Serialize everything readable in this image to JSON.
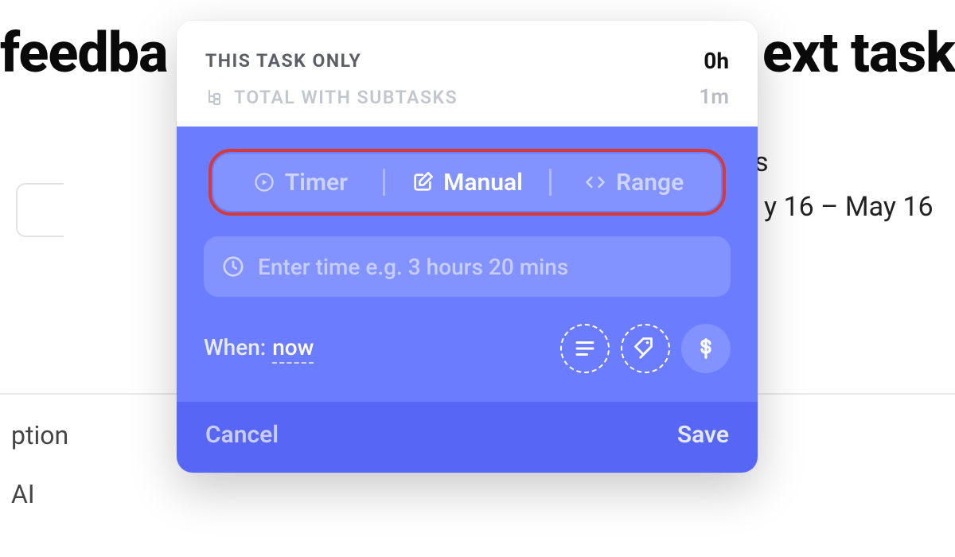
{
  "background": {
    "title_left_fragment": "feedba",
    "title_right_fragment": "ext task",
    "dates_line1": "es",
    "dates_line2": "y 16 – May 16",
    "description_fragment": "ption",
    "ai_fragment": "AI"
  },
  "popover": {
    "header": {
      "this_task_label": "THIS TASK ONLY",
      "this_task_value": "0h",
      "subtasks_label": "TOTAL WITH SUBTASKS",
      "subtasks_value": "1m"
    },
    "tabs": {
      "timer": "Timer",
      "manual": "Manual",
      "range": "Range"
    },
    "time_input_placeholder": "Enter time e.g. 3 hours 20 mins",
    "when": {
      "label": "When:",
      "value": "now"
    },
    "icons": {
      "subtask_tree": "subtask-tree-icon",
      "play": "play-circle-icon",
      "edit": "edit-square-icon",
      "range": "range-arrows-icon",
      "clock": "clock-icon",
      "notes": "notes-icon",
      "tags": "tags-icon",
      "dollar": "dollar-icon"
    },
    "footer": {
      "cancel": "Cancel",
      "save": "Save"
    }
  }
}
